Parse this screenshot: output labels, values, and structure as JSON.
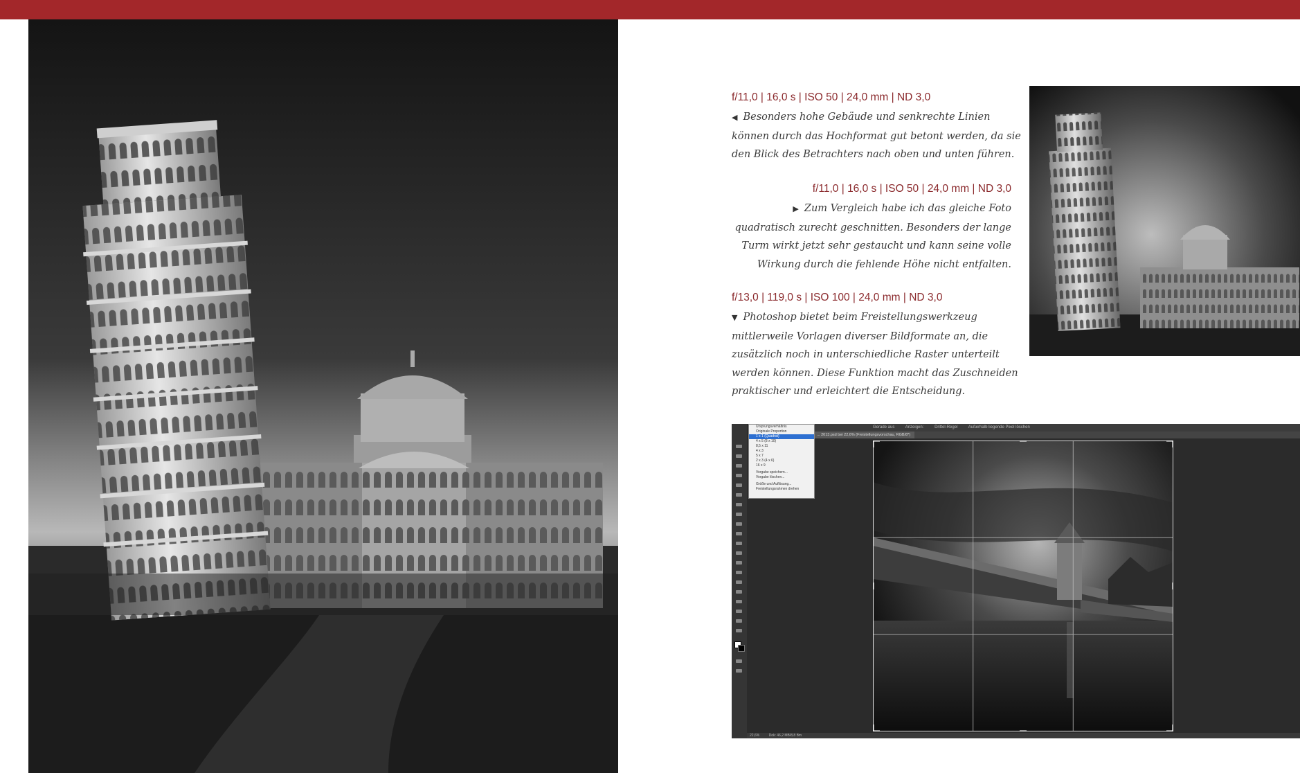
{
  "captions": {
    "first": {
      "meta": "f/11,0 | 16,0 s | ISO 50 | 24,0 mm | ND 3,0",
      "arrow": "◀",
      "text": "Besonders hohe Gebäude und senkrechte Linien können durch das Hochformat gut betont werden, da sie den Blick des Betrachters nach oben und unten führen."
    },
    "second": {
      "meta": "f/11,0 | 16,0 s | ISO 50 | 24,0 mm | ND 3,0",
      "arrow": "▶",
      "text": "Zum Vergleich habe ich das gleiche Foto quadratisch zurecht geschnitten. Besonders der lange Turm wirkt jetzt sehr gestaucht und kann seine volle Wirkung durch die fehlende Höhe nicht entfalten."
    },
    "third": {
      "meta": "f/13,0 | 119,0 s | ISO 100 | 24,0 mm | ND 3,0",
      "arrow": "▼",
      "text": "Photoshop bietet beim Freistellungswerkzeug mittlerweile Vorlagen diverser Bildformate an, die zusätzlich noch in unterschiedliche Raster unterteilt werden können. Diese Funktion macht das Zuschneiden praktischer und erleichtert die Entscheidung."
    }
  },
  "photoshop": {
    "toolbar": [
      "Gerade aus",
      "Anzeigen:",
      "Drittel-Regel",
      "Außerhalb liegende Pixel löschen"
    ],
    "document_tab": "... 2013.psd bei 22,6% (Freistellungsvorschau, RGB/8*)",
    "menu_items": [
      "Ursprungsverhältnis",
      "Originale Proportion",
      "1 x 1 (Quadrat)",
      "4 x 5 (8 x 10)",
      "8,5 x 11",
      "4 x 3",
      "5 x 7",
      "2 x 3 (4 x 6)",
      "16 x 9",
      "Vorgabe speichern...",
      "Vorgabe löschen...",
      "Größe und Auflösung...",
      "Freistellungsrahmen drehen"
    ],
    "status": [
      "22,6%",
      "Dok: 46,2 MB/8,8 Bm"
    ]
  },
  "colors": {
    "accent": "#a3272a",
    "meta_text": "#8b2a2d"
  }
}
